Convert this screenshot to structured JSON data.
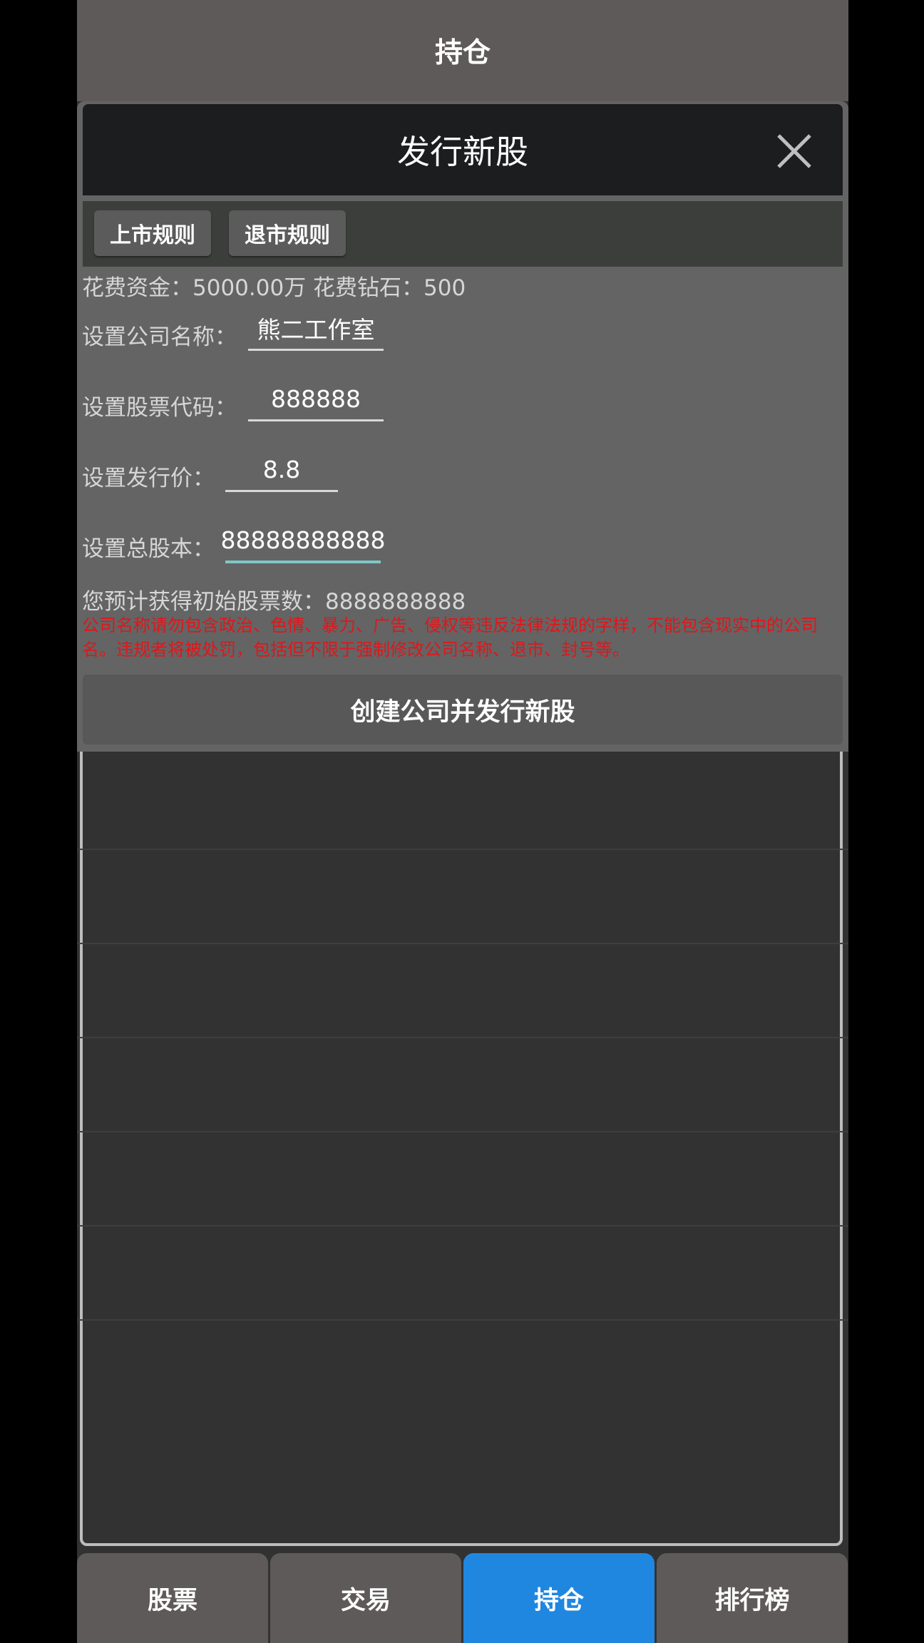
{
  "header": {
    "title": "持仓"
  },
  "dialog": {
    "title": "发行新股",
    "rules": {
      "listing": "上市规则",
      "delisting": "退市规则"
    },
    "cost_text": "花费资金：5000.00万 花费钻石：500",
    "fields": {
      "company_name": {
        "label": "设置公司名称：",
        "value": "熊二工作室"
      },
      "stock_code": {
        "label": "设置股票代码：",
        "value": "888888"
      },
      "issue_price": {
        "label": "设置发行价：",
        "value": "8.8"
      },
      "total_shares": {
        "label": "设置总股本：",
        "value": "88888888888"
      }
    },
    "expected_text": "您预计获得初始股票数：8888888888",
    "warning": "公司名称请勿包含政治、色情、暴力、广告、侵权等违反法律法规的字样，不能包含现实中的公司名。违规者将被处罚，包括但不限于强制修改公司名称、退市、封号等。",
    "create_button": "创建公司并发行新股"
  },
  "tabs": [
    {
      "label": "股票"
    },
    {
      "label": "交易"
    },
    {
      "label": "持仓"
    },
    {
      "label": "排行榜"
    }
  ],
  "colors": {
    "accent": "#2087e0",
    "warning": "#e0161a",
    "active_underline": "#7fc6c6"
  },
  "icons": {
    "close": "close-icon"
  }
}
